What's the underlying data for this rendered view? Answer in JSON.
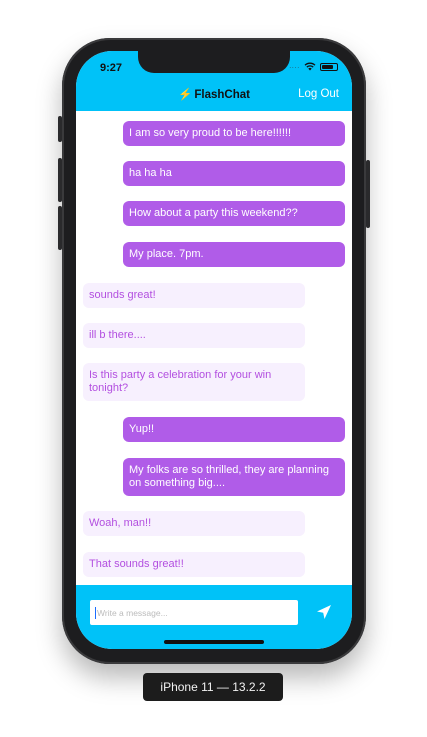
{
  "status_bar": {
    "time": "9:27",
    "signal": "....",
    "wifi_icon": "wifi-icon",
    "battery_icon": "battery-icon"
  },
  "nav": {
    "title_icon": "⚡",
    "title": "FlashChat",
    "logout_label": "Log Out"
  },
  "messages": [
    {
      "sender": "me",
      "text": "I am so very proud to be here!!!!!!"
    },
    {
      "sender": "me",
      "text": "ha ha ha"
    },
    {
      "sender": "me",
      "text": "How about a party this weekend??"
    },
    {
      "sender": "me",
      "text": "My place. 7pm."
    },
    {
      "sender": "other",
      "text": "sounds great!"
    },
    {
      "sender": "other",
      "text": "ill b there...."
    },
    {
      "sender": "other",
      "text": "Is this party a celebration for your win tonight?"
    },
    {
      "sender": "me",
      "text": "Yup!!"
    },
    {
      "sender": "me",
      "text": "My folks are so thrilled, they are planning on something big...."
    },
    {
      "sender": "other",
      "text": "Woah, man!!"
    },
    {
      "sender": "other",
      "text": "That sounds great!!"
    }
  ],
  "composer": {
    "placeholder": "Write a message...",
    "send_icon": "send-icon"
  },
  "device_caption": "iPhone 11 — 13.2.2",
  "colors": {
    "accent": "#00c2f8",
    "my_bubble": "#b05ce8",
    "their_bubble": "#f7f0fe",
    "their_text": "#b34fe0"
  }
}
